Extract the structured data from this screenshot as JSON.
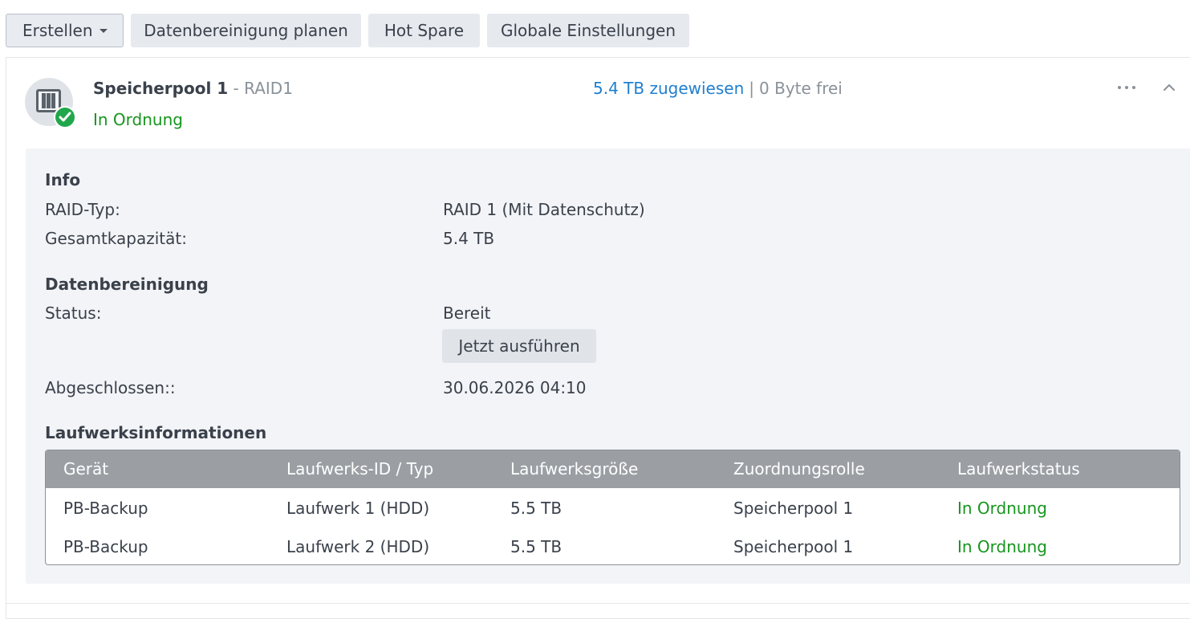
{
  "toolbar": {
    "create_label": "Erstellen",
    "scrub_label": "Datenbereinigung planen",
    "hotspare_label": "Hot Spare",
    "global_label": "Globale Einstellungen"
  },
  "pool": {
    "name": "Speicherpool 1",
    "separator": " - ",
    "raid": "RAID1",
    "status": "In Ordnung",
    "assigned": "5.4 TB zugewiesen",
    "pipe": "|",
    "free": "0 Byte frei",
    "status_color": "#17951f"
  },
  "info": {
    "heading": "Info",
    "raid_type_label": "RAID-Typ:",
    "raid_type_value": "RAID 1 (Mit Datenschutz)",
    "capacity_label": "Gesamtkapazität:",
    "capacity_value": "5.4 TB"
  },
  "scrubbing": {
    "heading": "Datenbereinigung",
    "status_label": "Status:",
    "status_value": "Bereit",
    "run_now_label": "Jetzt ausführen",
    "completed_label": "Abgeschlossen::",
    "completed_value": "30.06.2026 04:10"
  },
  "drives": {
    "heading": "Laufwerksinformationen",
    "columns": [
      "Gerät",
      "Laufwerks-ID / Typ",
      "Laufwerksgröße",
      "Zuordnungsrolle",
      "Laufwerkstatus"
    ],
    "rows": [
      [
        "PB-Backup",
        "Laufwerk 1 (HDD)",
        "5.5 TB",
        "Speicherpool 1",
        "In Ordnung"
      ],
      [
        "PB-Backup",
        "Laufwerk 2 (HDD)",
        "5.5 TB",
        "Speicherpool 1",
        "In Ordnung"
      ]
    ]
  },
  "icons": [
    "caret-down-icon",
    "storage-pool-icon",
    "check-badge-icon",
    "more-icon",
    "chevron-up-icon"
  ]
}
